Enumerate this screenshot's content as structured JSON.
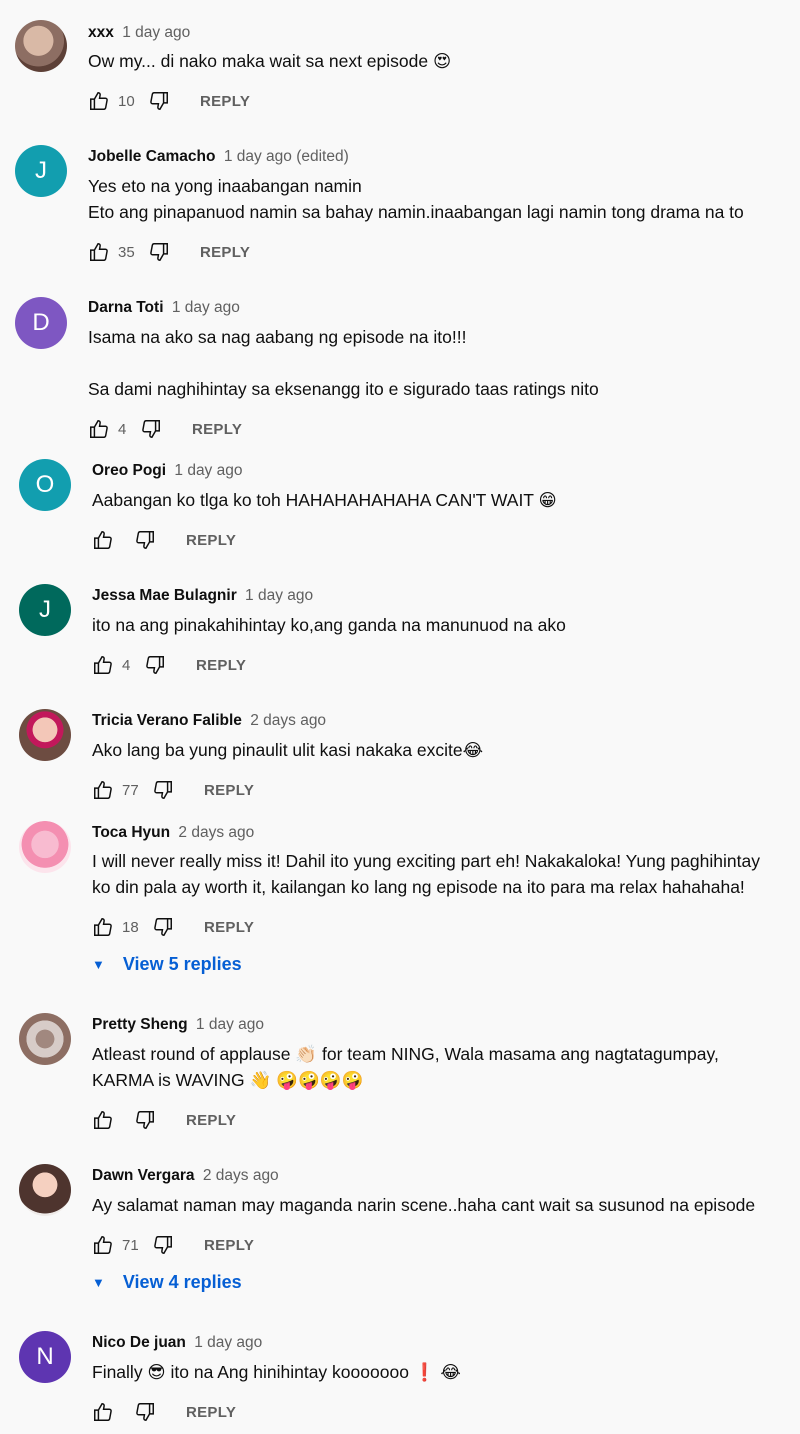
{
  "comments": [
    {
      "author": "xxx",
      "time": "1 day ago",
      "avatar_letter": "",
      "lines": [
        "Ow my... di nako maka wait sa next episode 😍"
      ],
      "likes": "10",
      "reply_label": "REPLY"
    },
    {
      "author": "Jobelle Camacho",
      "time": "1 day ago (edited)",
      "avatar_letter": "J",
      "avatar_color": "#129eaf",
      "lines": [
        "Yes eto na yong inaabangan namin",
        "Eto ang pinapanuod namin sa bahay namin.inaabangan lagi namin tong drama na to"
      ],
      "likes": "35",
      "reply_label": "REPLY"
    },
    {
      "author": "Darna Toti",
      "time": "1 day ago",
      "avatar_letter": "D",
      "avatar_color": "#7e57c2",
      "lines": [
        "Isama na ako sa nag aabang ng episode na ito!!!",
        "",
        "Sa dami naghihintay sa eksenangg ito e sigurado taas ratings nito"
      ],
      "likes": "4",
      "reply_label": "REPLY"
    },
    {
      "author": "Oreo Pogi",
      "time": "1 day ago",
      "avatar_letter": "O",
      "avatar_color": "#129eaf",
      "lines": [
        "Aabangan ko tlga ko toh HAHAHAHAHAHA CAN'T WAIT 😁"
      ],
      "likes": "",
      "reply_label": "REPLY"
    },
    {
      "author": "Jessa Mae Bulagnir",
      "time": "1 day ago",
      "avatar_letter": "J",
      "avatar_color": "#00695c",
      "lines": [
        "ito na ang pinakahihintay ko,ang ganda na manunuod na ako"
      ],
      "likes": "4",
      "reply_label": "REPLY"
    },
    {
      "author": "Tricia Verano Falible",
      "time": "2 days ago",
      "avatar_letter": "",
      "lines": [
        "Ako lang ba yung pinaulit ulit kasi nakaka excite😂"
      ],
      "likes": "77",
      "reply_label": "REPLY"
    },
    {
      "author": "Toca Hyun",
      "time": "2 days ago",
      "avatar_letter": "",
      "lines": [
        "I will never really miss it! Dahil ito yung exciting part eh! Nakakaloka! Yung paghihintay",
        "ko din pala ay worth it, kailangan ko lang ng episode na ito para ma relax hahahaha!"
      ],
      "likes": "18",
      "reply_label": "REPLY",
      "view_replies": "View 5 replies"
    },
    {
      "author": "Pretty Sheng",
      "time": "1 day ago",
      "avatar_letter": "",
      "lines": [
        "Atleast round of applause 👏🏻 for team NING, Wala masama ang nagtatagumpay,",
        "KARMA is WAVING 👋 🤪🤪🤪🤪"
      ],
      "likes": "",
      "reply_label": "REPLY"
    },
    {
      "author": "Dawn Vergara",
      "time": "2 days ago",
      "avatar_letter": "",
      "lines": [
        "Ay salamat naman may maganda narin scene..haha cant wait sa susunod na episode"
      ],
      "likes": "71",
      "reply_label": "REPLY",
      "view_replies": "View 4 replies"
    },
    {
      "author": "Nico De juan",
      "time": "1 day ago",
      "avatar_letter": "N",
      "avatar_color": "#5e35b1",
      "lines": [
        "Finally 😎 ito na Ang hinihintay kooooooo ❗ 😂"
      ],
      "likes": "",
      "reply_label": "REPLY"
    }
  ]
}
